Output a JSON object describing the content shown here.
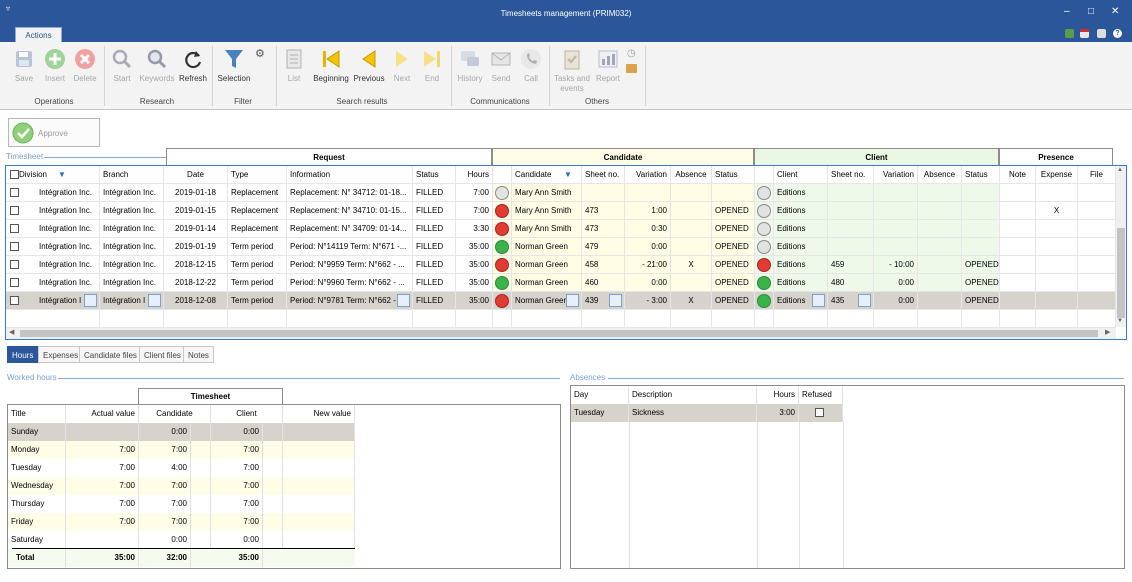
{
  "window": {
    "title": "Timesheets management (PRIM032)"
  },
  "ribbon": {
    "tab": "Actions",
    "buttons": {
      "save": "Save",
      "insert": "Insert",
      "delete": "Delete",
      "start": "Start",
      "keywords": "Keywords",
      "refresh": "Refresh",
      "selection": "Selection",
      "list": "List",
      "beginning": "Beginning",
      "previous": "Previous",
      "next": "Next",
      "end": "End",
      "history": "History",
      "send": "Send",
      "call": "Call",
      "tasks1": "Tasks and",
      "tasks2": "events",
      "report": "Report"
    },
    "groups": {
      "operations": "Operations",
      "research": "Research",
      "filter": "Filter",
      "search_results": "Search results",
      "communications": "Communications",
      "others": "Others"
    }
  },
  "approve_label": "Approve",
  "timesheet_section": "Timesheet",
  "bands": {
    "request": "Request",
    "candidate": "Candidate",
    "client": "Client",
    "presence": "Presence"
  },
  "columns": {
    "division": "Division",
    "branch": "Branch",
    "date": "Date",
    "type": "Type",
    "information": "Information",
    "status": "Status",
    "hours": "Hours",
    "candidate": "Candidate",
    "sheet_no": "Sheet no.",
    "variation": "Variation",
    "absence": "Absence",
    "cand_status": "Status",
    "client": "Client",
    "cl_sheet_no": "Sheet no.",
    "cl_variation": "Variation",
    "cl_absence": "Absence",
    "cl_status": "Status",
    "note": "Note",
    "expense": "Expense",
    "file": "File"
  },
  "rows": [
    {
      "division": "Intégration Inc.",
      "branch": "Intégration Inc.",
      "date": "2019-01-18",
      "type": "Replacement",
      "info": "Replacement: N° 34712: 01-18...",
      "status": "FILLED",
      "hours": "7:00",
      "dot1": "grey",
      "candidate": "Mary Ann Smith",
      "sheet": "",
      "variation": "",
      "absence": "",
      "cstatus": "",
      "dot2": "grey",
      "client": "Editions",
      "clsheet": "",
      "clvar": "",
      "clabs": "",
      "clstatus": "",
      "note": "",
      "expense": "",
      "file": ""
    },
    {
      "division": "Intégration Inc.",
      "branch": "Intégration Inc.",
      "date": "2019-01-15",
      "type": "Replacement",
      "info": "Replacement: N° 34710: 01-15...",
      "status": "FILLED",
      "hours": "7:00",
      "dot1": "red",
      "candidate": "Mary Ann Smith",
      "sheet": "473",
      "variation": "1:00",
      "absence": "",
      "cstatus": "OPENED",
      "dot2": "grey",
      "client": "Editions",
      "clsheet": "",
      "clvar": "",
      "clabs": "",
      "clstatus": "",
      "note": "",
      "expense": "X",
      "file": ""
    },
    {
      "division": "Intégration Inc.",
      "branch": "Intégration Inc.",
      "date": "2019-01-14",
      "type": "Replacement",
      "info": "Replacement: N° 34709: 01-14...",
      "status": "FILLED",
      "hours": "3:30",
      "dot1": "red",
      "candidate": "Mary Ann Smith",
      "sheet": "473",
      "variation": "0:30",
      "absence": "",
      "cstatus": "OPENED",
      "dot2": "grey",
      "client": "Editions",
      "clsheet": "",
      "clvar": "",
      "clabs": "",
      "clstatus": "",
      "note": "",
      "expense": "",
      "file": ""
    },
    {
      "division": "Intégration Inc.",
      "branch": "Intégration Inc.",
      "date": "2019-01-19",
      "type": "Term period",
      "info": "Period: N°14119 Term: N°671 -...",
      "status": "FILLED",
      "hours": "35:00",
      "dot1": "green",
      "candidate": "Norman Green",
      "sheet": "479",
      "variation": "0:00",
      "absence": "",
      "cstatus": "OPENED",
      "dot2": "grey",
      "client": "Editions",
      "clsheet": "",
      "clvar": "",
      "clabs": "",
      "clstatus": "",
      "note": "",
      "expense": "",
      "file": ""
    },
    {
      "division": "Intégration Inc.",
      "branch": "Intégration Inc.",
      "date": "2018-12-15",
      "type": "Term period",
      "info": "Period: N°9959 Term: N°662 - ...",
      "status": "FILLED",
      "hours": "35:00",
      "dot1": "red",
      "candidate": "Norman Green",
      "sheet": "458",
      "variation": "- 21:00",
      "absence": "X",
      "cstatus": "OPENED",
      "dot2": "red",
      "client": "Editions",
      "clsheet": "459",
      "clvar": "- 10:00",
      "clabs": "",
      "clstatus": "OPENED",
      "note": "",
      "expense": "",
      "file": ""
    },
    {
      "division": "Intégration Inc.",
      "branch": "Intégration Inc.",
      "date": "2018-12-22",
      "type": "Term period",
      "info": "Period: N°9960 Term: N°662 - ...",
      "status": "FILLED",
      "hours": "35:00",
      "dot1": "green",
      "candidate": "Norman Green",
      "sheet": "460",
      "variation": "0:00",
      "absence": "",
      "cstatus": "OPENED",
      "dot2": "green",
      "client": "Editions",
      "clsheet": "480",
      "clvar": "0:00",
      "clabs": "",
      "clstatus": "OPENED",
      "note": "",
      "expense": "",
      "file": ""
    },
    {
      "division": "Intégration I",
      "branch": "Intégration I",
      "date": "2018-12-08",
      "type": "Term period",
      "info": "Period: N°9781 Term: N°662 -",
      "status": "FILLED",
      "hours": "35:00",
      "dot1": "red",
      "candidate": "Norman Green",
      "sheet": "439",
      "variation": "- 3:00",
      "absence": "X",
      "cstatus": "OPENED",
      "dot2": "green",
      "client": "Editions",
      "clsheet": "435",
      "clvar": "0:00",
      "clabs": "",
      "clstatus": "OPENED",
      "note": "",
      "expense": "",
      "file": ""
    }
  ],
  "bottom_tabs": [
    "Hours",
    "Expenses",
    "Candidate files",
    "Client files",
    "Notes"
  ],
  "worked_hours": {
    "section": "Worked hours",
    "band": "Timesheet",
    "headers": {
      "title": "Title",
      "actual": "Actual value",
      "candidate": "Candidate",
      "client": "Client",
      "new": "New value"
    },
    "rows": [
      {
        "title": "Sunday",
        "actual": "",
        "candidate": "0:00",
        "client": "0:00"
      },
      {
        "title": "Monday",
        "actual": "7:00",
        "candidate": "7:00",
        "client": "7:00"
      },
      {
        "title": "Tuesday",
        "actual": "7:00",
        "candidate": "4:00",
        "client": "7:00"
      },
      {
        "title": "Wednesday",
        "actual": "7:00",
        "candidate": "7:00",
        "client": "7:00"
      },
      {
        "title": "Thursday",
        "actual": "7:00",
        "candidate": "7:00",
        "client": "7:00"
      },
      {
        "title": "Friday",
        "actual": "7:00",
        "candidate": "7:00",
        "client": "7:00"
      },
      {
        "title": "Saturday",
        "actual": "",
        "candidate": "0:00",
        "client": "0:00"
      }
    ],
    "total": {
      "title": "Total",
      "actual": "35:00",
      "candidate": "32:00",
      "client": "35:00"
    }
  },
  "absences": {
    "section": "Absences",
    "headers": {
      "day": "Day",
      "description": "Description",
      "hours": "Hours",
      "refused": "Refused"
    },
    "rows": [
      {
        "day": "Tuesday",
        "description": "Sickness",
        "hours": "3:00"
      }
    ]
  }
}
